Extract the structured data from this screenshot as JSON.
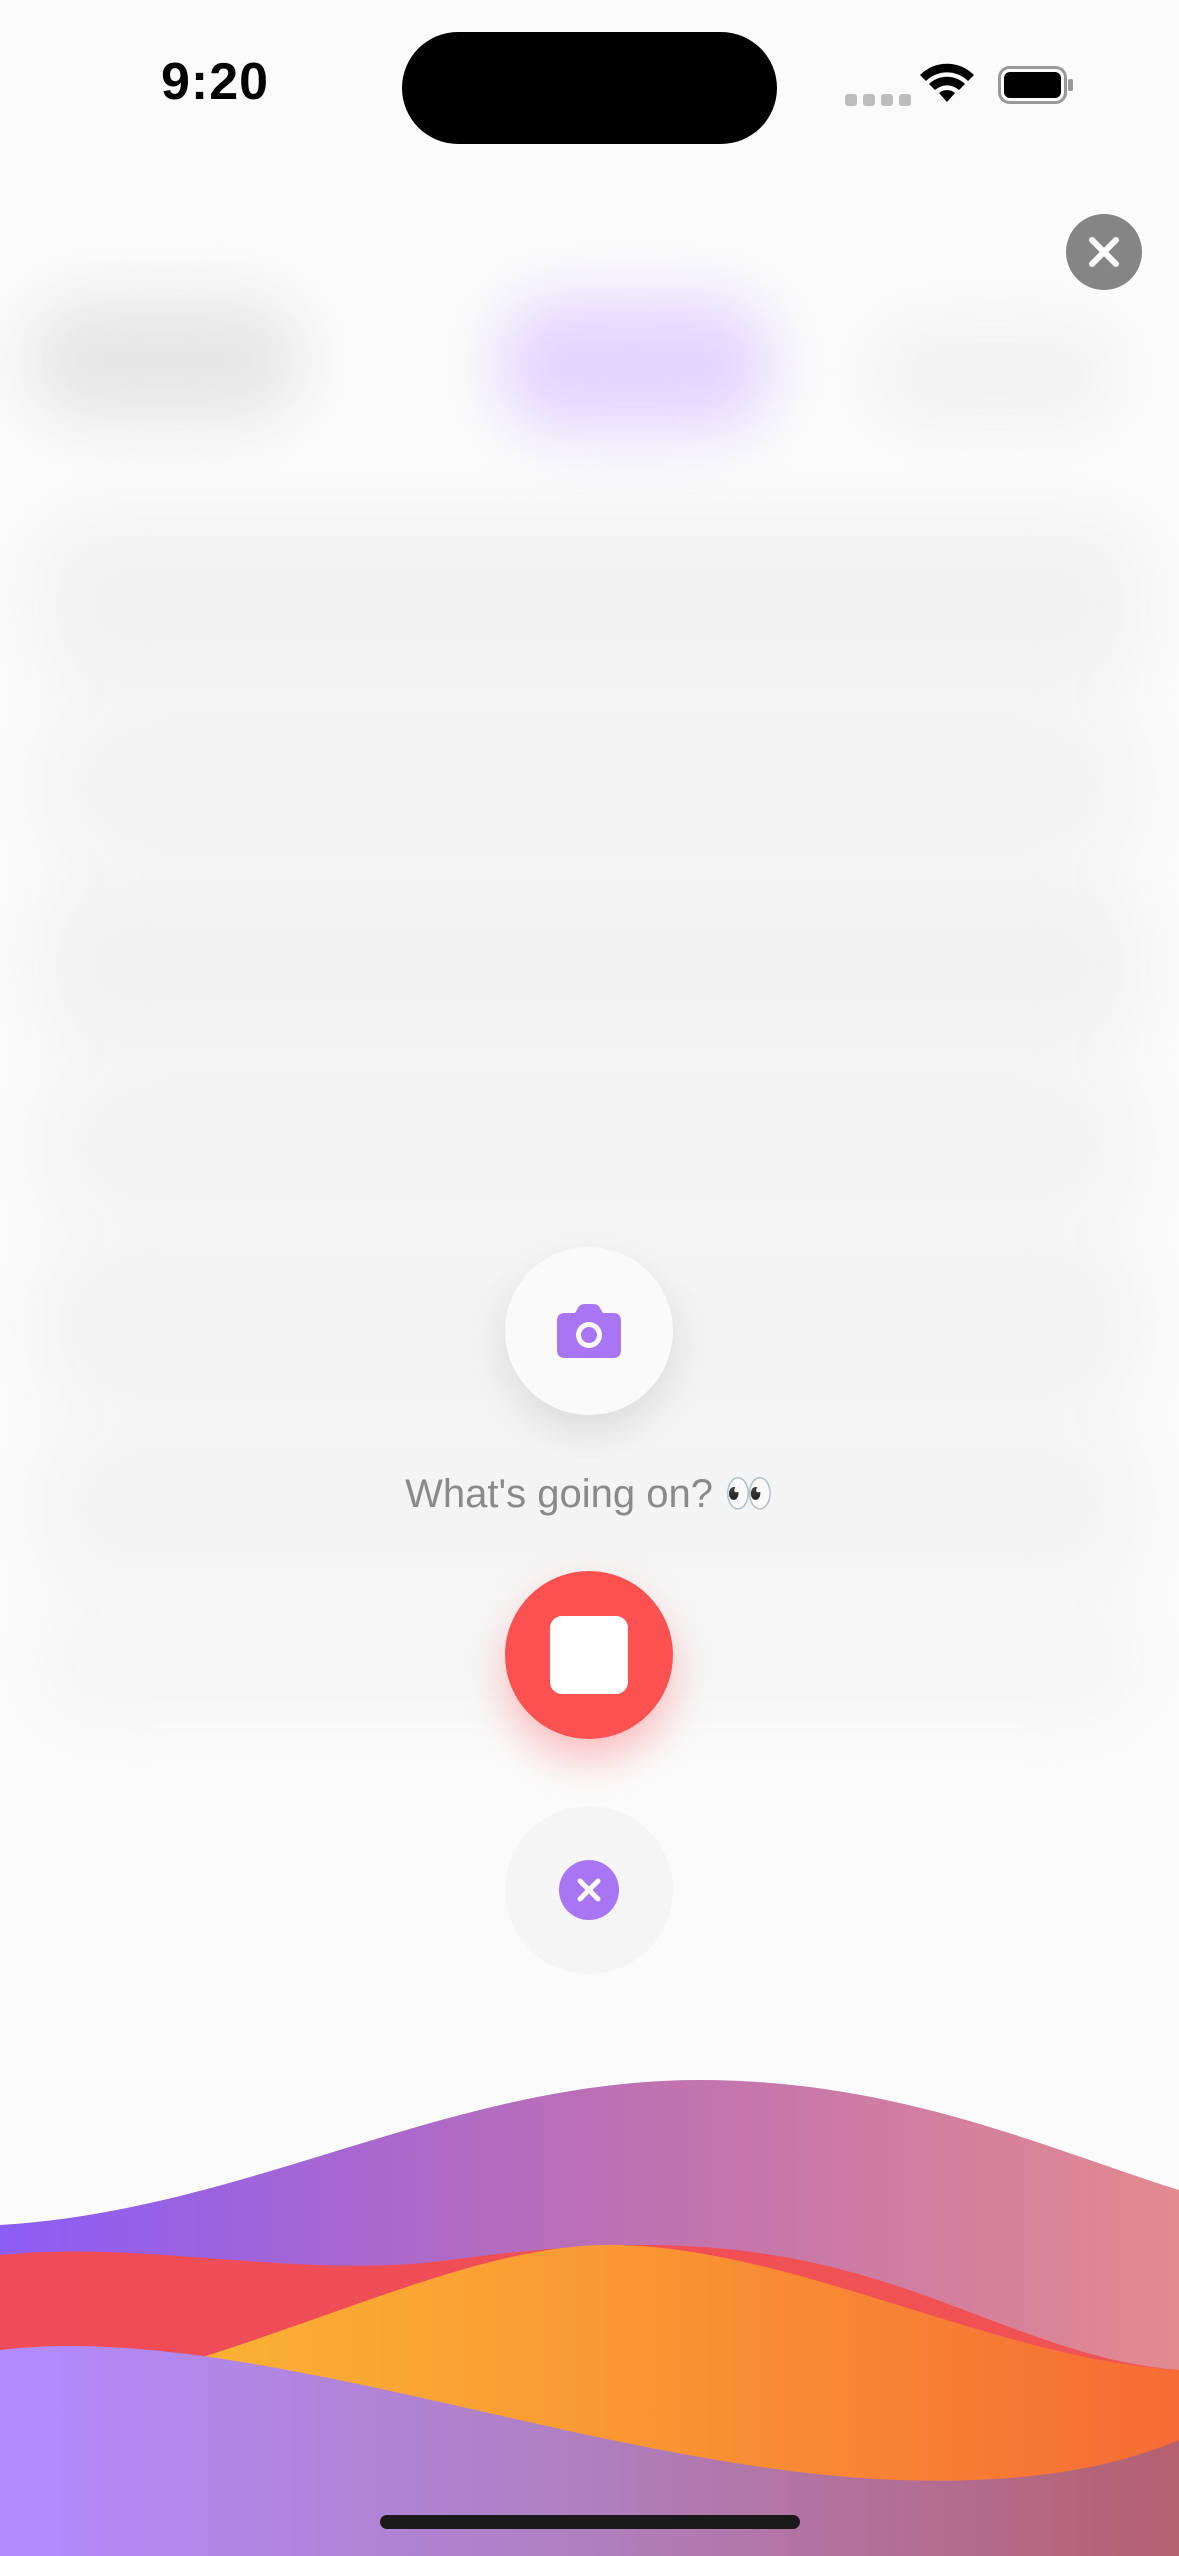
{
  "status_bar": {
    "time": "9:20"
  },
  "prompt": {
    "text": "What's going on? 👀"
  },
  "icons": {
    "close_top": "close-icon",
    "camera": "camera-icon",
    "stop": "stop-icon",
    "cancel": "close-icon",
    "wifi": "wifi-icon",
    "battery": "battery-icon"
  },
  "colors": {
    "accent_purple": "#a876f4",
    "record_red": "#fb5151",
    "close_gray": "#858585",
    "wave_purple": "#8b5cf6",
    "wave_pink": "#d98394",
    "wave_red": "#f74a4a",
    "wave_yellow": "#fcc831",
    "wave_orange": "#f97f2f"
  }
}
